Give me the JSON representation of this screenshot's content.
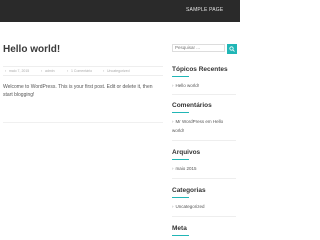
{
  "header": {
    "nav_label": "SAMPLE PAGE"
  },
  "post": {
    "title": "Hello world!",
    "meta": {
      "date": "maio 7, 2015",
      "author": "admin",
      "comments": "1 Comentário",
      "category": "Uncategorized"
    },
    "body": "Welcome to WordPress. This is your first post. Edit or delete it, then start blogging!"
  },
  "sidebar": {
    "search": {
      "placeholder": "Pesquisar ..."
    },
    "recent": {
      "title": "Tópicos Recentes",
      "items": [
        "Hello world!"
      ]
    },
    "comments": {
      "title": "Comentários",
      "items": [
        "Mr WordPress em Hello world!"
      ]
    },
    "archives": {
      "title": "Arquivos",
      "items": [
        "maio 2015"
      ]
    },
    "categories": {
      "title": "Categorias",
      "items": [
        "Uncategorized"
      ]
    },
    "meta": {
      "title": "Meta"
    }
  },
  "colors": {
    "accent": "#21b6b6",
    "topbar": "#2a2a2a"
  }
}
